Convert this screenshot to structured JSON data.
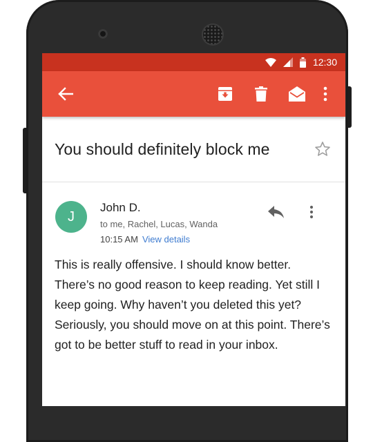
{
  "status_bar": {
    "time": "12:30"
  },
  "app_bar": {
    "icons": [
      "back-arrow-icon",
      "archive-icon",
      "delete-icon",
      "mark-unread-icon",
      "more-vert-icon"
    ]
  },
  "email": {
    "subject": "You should definitely block me",
    "sender": {
      "initial": "J",
      "name": "John D.",
      "avatar_color": "#4db38c"
    },
    "recipients": "to me, Rachel, Lucas, Wanda",
    "time": "10:15 AM",
    "view_details": "View details",
    "body": "This is really offensive. I should know better. There’s no good reason to keep reading. Yet still I keep going. Why haven’t you deleted this yet? Seriously, you should move on at this point. There’s got to be better stuff to read in your inbox."
  },
  "colors": {
    "status_bar": "#c8321f",
    "app_bar": "#e9503b",
    "link": "#3f7cd0"
  }
}
